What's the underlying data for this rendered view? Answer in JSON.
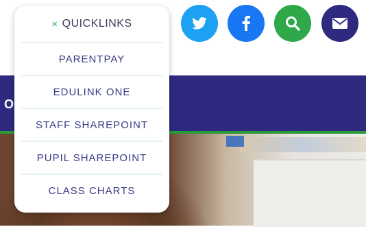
{
  "navbar": {
    "partial_text": "ON"
  },
  "social": [
    {
      "name": "twitter",
      "icon": "twitter-icon",
      "color": "#1da1f2"
    },
    {
      "name": "facebook",
      "icon": "facebook-icon",
      "color": "#1877f2"
    },
    {
      "name": "search",
      "icon": "search-icon",
      "color": "#2fa84a"
    },
    {
      "name": "email",
      "icon": "envelope-icon",
      "color": "#2e2a7f"
    }
  ],
  "quicklinks": {
    "close_symbol": "×",
    "title": "QUICKLINKS",
    "items": [
      {
        "label": "PARENTPAY"
      },
      {
        "label": "EDULINK ONE"
      },
      {
        "label": "STAFF SHAREPOINT"
      },
      {
        "label": "PUPIL SHAREPOINT"
      },
      {
        "label": "CLASS CHARTS"
      }
    ]
  },
  "colors": {
    "brand_navy": "#2e2a7f",
    "accent_green": "#2fa84a",
    "link_text": "#3b3a86"
  }
}
